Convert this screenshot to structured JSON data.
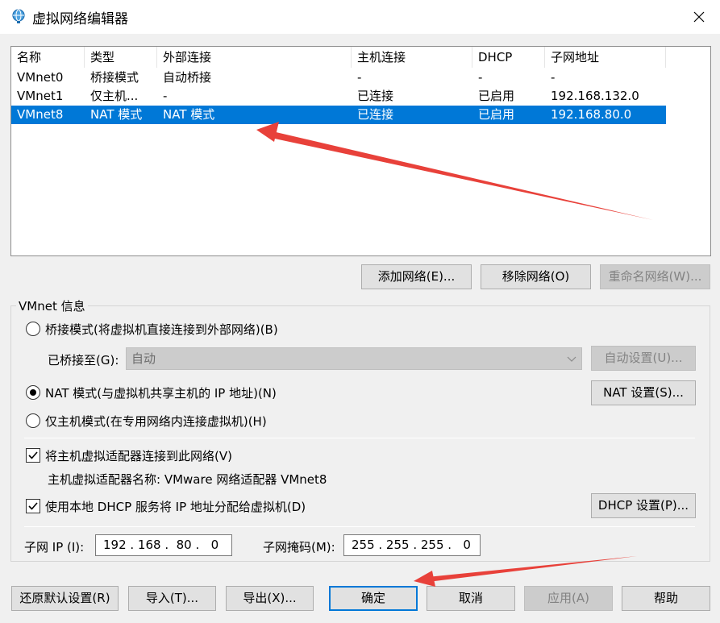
{
  "window": {
    "title": "虚拟网络编辑器",
    "close_glyph": "✕"
  },
  "table": {
    "headers": [
      "名称",
      "类型",
      "外部连接",
      "主机连接",
      "DHCP",
      "子网地址"
    ],
    "rows": [
      {
        "name": "VMnet0",
        "type": "桥接模式",
        "external": "自动桥接",
        "host": "-",
        "dhcp": "-",
        "subnet": "-"
      },
      {
        "name": "VMnet1",
        "type": "仅主机...",
        "external": "-",
        "host": "已连接",
        "dhcp": "已启用",
        "subnet": "192.168.132.0"
      },
      {
        "name": "VMnet8",
        "type": "NAT 模式",
        "external": "NAT 模式",
        "host": "已连接",
        "dhcp": "已启用",
        "subnet": "192.168.80.0"
      }
    ],
    "selected_row": "VMnet8"
  },
  "net_buttons": {
    "add": "添加网络(E)...",
    "remove": "移除网络(O)",
    "rename": "重命名网络(W)..."
  },
  "info": {
    "group_label": "VMnet 信息",
    "bridge_radio": "桥接模式(将虚拟机直接连接到外部网络)(B)",
    "bridged_to_label": "已桥接至(G):",
    "bridged_to_value": "自动",
    "auto_settings": "自动设置(U)...",
    "nat_radio": "NAT 模式(与虚拟机共享主机的 IP 地址)(N)",
    "nat_settings": "NAT 设置(S)...",
    "hostonly_radio": "仅主机模式(在专用网络内连接虚拟机)(H)",
    "selected_mode": "nat",
    "connect_adapter": "将主机虚拟适配器连接到此网络(V)",
    "adapter_name": "主机虚拟适配器名称: VMware 网络适配器 VMnet8",
    "use_dhcp": "使用本地 DHCP 服务将 IP 地址分配给虚拟机(D)",
    "dhcp_settings": "DHCP 设置(P)...",
    "subnet_ip_label": "子网 IP (I):",
    "subnet_ip": "192 . 168 .  80 .   0",
    "subnet_mask_label": "子网掩码(M):",
    "subnet_mask": "255 . 255 . 255 .   0",
    "connect_adapter_checked": true,
    "use_dhcp_checked": true
  },
  "bottom_buttons": {
    "restore": "还原默认设置(R)",
    "import": "导入(T)...",
    "export": "导出(X)...",
    "ok": "确定",
    "cancel": "取消",
    "apply": "应用(A)",
    "help": "帮助"
  },
  "colors": {
    "selection": "#0078d7",
    "annotation_arrow": "#e8413a"
  }
}
